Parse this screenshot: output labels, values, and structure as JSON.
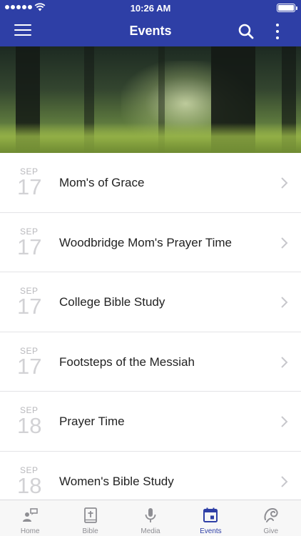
{
  "status_bar": {
    "time": "10:26 AM"
  },
  "header": {
    "title": "Events"
  },
  "events": [
    {
      "month": "SEP",
      "day": "17",
      "title": "Mom's of Grace"
    },
    {
      "month": "SEP",
      "day": "17",
      "title": "Woodbridge Mom's Prayer Time"
    },
    {
      "month": "SEP",
      "day": "17",
      "title": "College Bible Study"
    },
    {
      "month": "SEP",
      "day": "17",
      "title": "Footsteps of the Messiah"
    },
    {
      "month": "SEP",
      "day": "18",
      "title": "Prayer Time"
    },
    {
      "month": "SEP",
      "day": "18",
      "title": "Women's Bible Study"
    }
  ],
  "tabs": [
    {
      "label": "Home",
      "icon": "home-icon"
    },
    {
      "label": "Bible",
      "icon": "bible-icon"
    },
    {
      "label": "Media",
      "icon": "microphone-icon"
    },
    {
      "label": "Events",
      "icon": "calendar-icon",
      "active": true
    },
    {
      "label": "Give",
      "icon": "give-icon"
    }
  ],
  "colors": {
    "brand": "#2e3fa6",
    "inactive_tab": "#8e8e93",
    "date_text": "#c4c4c8"
  }
}
